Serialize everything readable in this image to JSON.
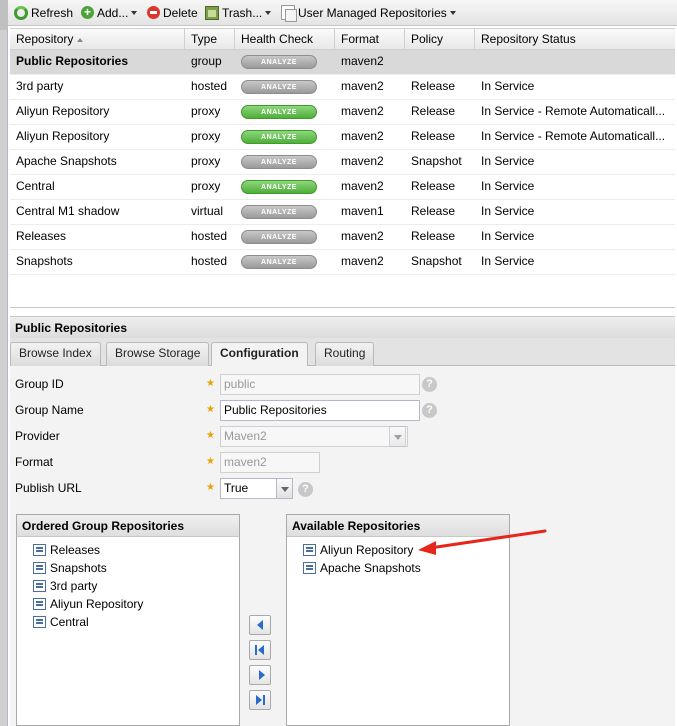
{
  "toolbar": {
    "refresh": "Refresh",
    "add": "Add...",
    "delete": "Delete",
    "trash": "Trash...",
    "user_managed": "User Managed Repositories"
  },
  "grid": {
    "columns": [
      "Repository",
      "Type",
      "Health Check",
      "Format",
      "Policy",
      "Repository Status"
    ],
    "analyze_label": "ANALYZE",
    "rows": [
      {
        "name": "Public Repositories",
        "type": "group",
        "health": "grey",
        "format": "maven2",
        "policy": "",
        "status": ""
      },
      {
        "name": "3rd party",
        "type": "hosted",
        "health": "grey",
        "format": "maven2",
        "policy": "Release",
        "status": "In Service"
      },
      {
        "name": "Aliyun Repository",
        "type": "proxy",
        "health": "green",
        "format": "maven2",
        "policy": "Release",
        "status": "In Service - Remote Automaticall..."
      },
      {
        "name": "Aliyun Repository",
        "type": "proxy",
        "health": "green",
        "format": "maven2",
        "policy": "Release",
        "status": "In Service - Remote Automaticall..."
      },
      {
        "name": "Apache Snapshots",
        "type": "proxy",
        "health": "grey",
        "format": "maven2",
        "policy": "Snapshot",
        "status": "In Service"
      },
      {
        "name": "Central",
        "type": "proxy",
        "health": "green",
        "format": "maven2",
        "policy": "Release",
        "status": "In Service"
      },
      {
        "name": "Central M1 shadow",
        "type": "virtual",
        "health": "grey",
        "format": "maven1",
        "policy": "Release",
        "status": "In Service"
      },
      {
        "name": "Releases",
        "type": "hosted",
        "health": "grey",
        "format": "maven2",
        "policy": "Release",
        "status": "In Service"
      },
      {
        "name": "Snapshots",
        "type": "hosted",
        "health": "grey",
        "format": "maven2",
        "policy": "Snapshot",
        "status": "In Service"
      }
    ]
  },
  "detail": {
    "title": "Public Repositories",
    "tabs": [
      "Browse Index",
      "Browse Storage",
      "Configuration",
      "Routing"
    ],
    "active_tab": "Configuration",
    "fields": {
      "group_id_label": "Group ID",
      "group_id_value": "public",
      "group_name_label": "Group Name",
      "group_name_value": "Public Repositories",
      "provider_label": "Provider",
      "provider_value": "Maven2",
      "format_label": "Format",
      "format_value": "maven2",
      "publish_label": "Publish URL",
      "publish_value": "True"
    },
    "ordered_title": "Ordered Group Repositories",
    "ordered": [
      "Releases",
      "Snapshots",
      "3rd party",
      "Aliyun Repository",
      "Central"
    ],
    "available_title": "Available Repositories",
    "available": [
      "Aliyun Repository",
      "Apache Snapshots"
    ]
  },
  "colors": {
    "annotation_arrow": "#e8251b",
    "analyze_green": "#4fae3a",
    "analyze_grey": "#9a9a9a",
    "selected_row": "#d9d9d9"
  }
}
